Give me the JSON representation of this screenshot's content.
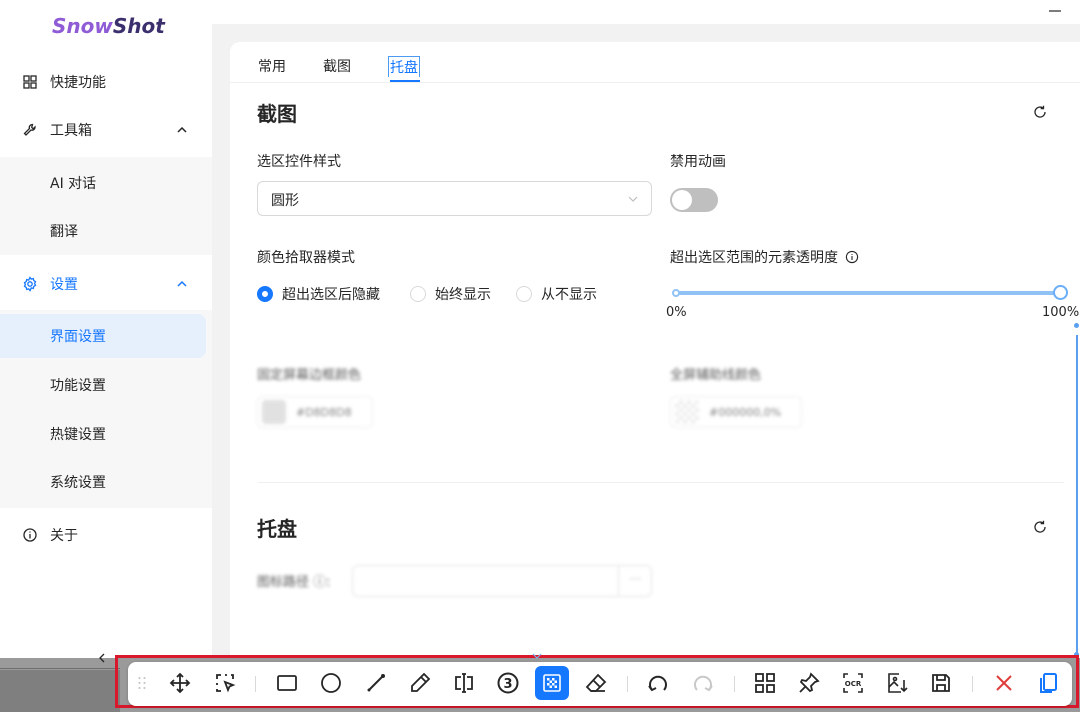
{
  "app": {
    "logo_snow": "Snow",
    "logo_shot": "Shot"
  },
  "sidebar": {
    "items": [
      {
        "label": "快捷功能",
        "icon": "grid-icon"
      },
      {
        "label": "工具箱",
        "icon": "wrench-icon",
        "expanded": true
      },
      {
        "label": "设置",
        "icon": "gear-icon",
        "expanded": true
      },
      {
        "label": "关于",
        "icon": "info-icon"
      }
    ],
    "toolbox_children": [
      "AI 对话",
      "翻译"
    ],
    "settings_children": [
      "界面设置",
      "功能设置",
      "热键设置",
      "系统设置"
    ],
    "active_child": "界面设置"
  },
  "tabs": {
    "items": [
      "常用",
      "截图",
      "托盘"
    ],
    "active": "托盘"
  },
  "screenshot_section": {
    "title": "截图",
    "selection_style_label": "选区控件样式",
    "selection_style_value": "圆形",
    "disable_animation_label": "禁用动画",
    "disable_animation_on": false,
    "color_picker_mode_label": "颜色拾取器模式",
    "color_picker_options": [
      "超出选区后隐藏",
      "始终显示",
      "从不显示"
    ],
    "color_picker_selected": "超出选区后隐藏",
    "opacity_label": "超出选区范围的元素透明度",
    "opacity_value_percent": 100,
    "opacity_min_label": "0%",
    "opacity_max_label": "100%",
    "fixed_border_color_label": "固定屏幕边框颜色",
    "fixed_border_color_value": "#D8D8D8",
    "fullscreen_guide_color_label": "全屏辅助线颜色",
    "fullscreen_guide_color_value": "#000000,0%"
  },
  "tray_section": {
    "title": "托盘",
    "icon_path_label": "图标路径",
    "icon_path_value": "",
    "browse_label": "···"
  },
  "toolbar": {
    "tools": [
      "drag-handle-icon",
      "move-icon",
      "select-region-icon",
      "rectangle-icon",
      "ellipse-icon",
      "arrow-icon",
      "pen-icon",
      "text-icon",
      "serial-number-icon",
      "mosaic-icon",
      "eraser-icon",
      "undo-icon",
      "redo-icon",
      "grid-icon",
      "pin-icon",
      "ocr-icon",
      "image-export-icon",
      "save-icon",
      "close-icon",
      "copy-icon"
    ],
    "active_tool": "mosaic-icon",
    "serial_number": "3",
    "ocr_text": "OCR"
  },
  "colors": {
    "accent": "#1677ff",
    "close": "#e03c3c",
    "logo_snow": "#8f5cd6",
    "logo_shot": "#3b2f6e",
    "toolbar_frame": "#d9192b"
  }
}
